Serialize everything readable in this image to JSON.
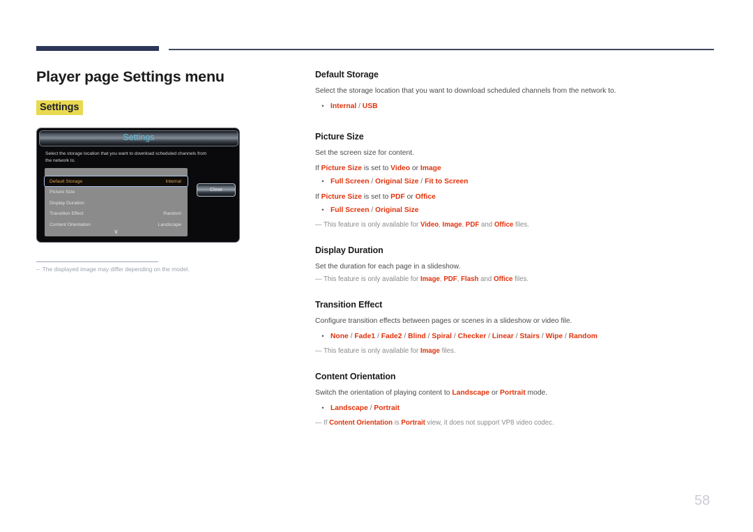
{
  "header": {
    "title": "Player page Settings menu",
    "chip_label": "Settings"
  },
  "device": {
    "title": "Settings",
    "description": "Select the storage location that you want to download scheduled channels from the network to.",
    "close_label": "Close",
    "scroll_icon": "chevron-down-icon",
    "rows": [
      {
        "label": "Default Storage",
        "value": "Internal",
        "selected": true
      },
      {
        "label": "Picture Size",
        "value": "",
        "selected": false
      },
      {
        "label": "Display Duration",
        "value": "",
        "selected": false
      },
      {
        "label": "Transition Effect",
        "value": "Random",
        "selected": false
      },
      {
        "label": "Content Orientation",
        "value": "Landscape",
        "selected": false
      }
    ]
  },
  "image_footnote": {
    "dash": "–",
    "text": "The displayed image may differ depending on the model."
  },
  "sections": {
    "default_storage": {
      "title": "Default Storage",
      "desc": "Select the storage location that you want to download scheduled channels from the network to.",
      "options": "Internal / USB"
    },
    "picture_size": {
      "title": "Picture Size",
      "desc": "Set the screen size for content.",
      "cond1_pre": "If ",
      "cond1_kw": "Picture Size",
      "cond1_mid": " is set to ",
      "cond1_kw2": "Video",
      "cond1_or": " or ",
      "cond1_kw3": "Image",
      "options1": "Full Screen / Original Size / Fit to Screen",
      "cond2_pre": "If ",
      "cond2_kw": "Picture Size",
      "cond2_mid": " is set to ",
      "cond2_kw2": "PDF",
      "cond2_or": " or ",
      "cond2_kw3": "Office",
      "options2": "Full Screen / Original Size",
      "note_pre": "This feature is only available for ",
      "note_kw1": "Video",
      "note_sep1": ", ",
      "note_kw2": "Image",
      "note_sep2": ", ",
      "note_kw3": "PDF",
      "note_sep3": " and ",
      "note_kw4": "Office",
      "note_post": " files."
    },
    "display_duration": {
      "title": "Display Duration",
      "desc": "Set the duration for each page in a slideshow.",
      "note_pre": "This feature is only available for ",
      "note_kw1": "Image",
      "note_sep1": ", ",
      "note_kw2": "PDF",
      "note_sep2": ", ",
      "note_kw3": "Flash",
      "note_sep3": " and ",
      "note_kw4": "Office",
      "note_post": " files."
    },
    "transition_effect": {
      "title": "Transition Effect",
      "desc": "Configure transition effects between pages or scenes in a slideshow or video file.",
      "options": "None / Fade1 / Fade2 / Blind / Spiral / Checker / Linear / Stairs / Wipe / Random",
      "note_pre": "This feature is only available for ",
      "note_kw1": "Image",
      "note_post": " files."
    },
    "content_orientation": {
      "title": "Content Orientation",
      "desc_pre": "Switch the orientation of playing content to ",
      "desc_kw1": "Landscape",
      "desc_or": " or ",
      "desc_kw2": "Portrait",
      "desc_post": " mode.",
      "options": "Landscape / Portrait",
      "note_pre": "If ",
      "note_kw1": "Content Orientation",
      "note_mid": " is ",
      "note_kw2": "Portrait",
      "note_post": " view, it does not support VP8 video codec."
    }
  },
  "footer": {
    "page_number": "58"
  },
  "note_dash": "—"
}
